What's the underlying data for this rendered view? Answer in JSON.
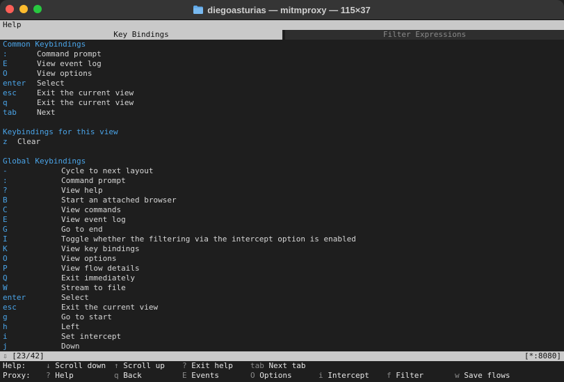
{
  "window": {
    "title": "diegoasturias — mitmproxy — 115×37"
  },
  "help_title": "Help",
  "tabs": [
    {
      "label": "Key Bindings",
      "active": true
    },
    {
      "label": "Filter Expressions",
      "active": false
    }
  ],
  "common": {
    "title": "Common Keybindings",
    "items": [
      {
        "key": ":",
        "desc": "Command prompt"
      },
      {
        "key": "E",
        "desc": "View event log"
      },
      {
        "key": "O",
        "desc": "View options"
      },
      {
        "key": "enter",
        "desc": "Select"
      },
      {
        "key": "esc",
        "desc": "Exit the current view"
      },
      {
        "key": "q",
        "desc": "Exit the current view"
      },
      {
        "key": "tab",
        "desc": "Next"
      }
    ]
  },
  "view": {
    "title": "Keybindings for this view",
    "items": [
      {
        "key": "z",
        "desc": "Clear"
      }
    ]
  },
  "global": {
    "title": "Global Keybindings",
    "items": [
      {
        "key": "-",
        "desc": "Cycle to next layout"
      },
      {
        "key": ":",
        "desc": "Command prompt"
      },
      {
        "key": "?",
        "desc": "View help"
      },
      {
        "key": "B",
        "desc": "Start an attached browser"
      },
      {
        "key": "C",
        "desc": "View commands"
      },
      {
        "key": "E",
        "desc": "View event log"
      },
      {
        "key": "G",
        "desc": "Go to end"
      },
      {
        "key": "I",
        "desc": "Toggle whether the filtering via the intercept option is enabled"
      },
      {
        "key": "K",
        "desc": "View key bindings"
      },
      {
        "key": "O",
        "desc": "View options"
      },
      {
        "key": "P",
        "desc": "View flow details"
      },
      {
        "key": "Q",
        "desc": "Exit immediately"
      },
      {
        "key": "W",
        "desc": "Stream to file"
      },
      {
        "key": "enter",
        "desc": "Select"
      },
      {
        "key": "esc",
        "desc": "Exit the current view"
      },
      {
        "key": "g",
        "desc": "Go to start"
      },
      {
        "key": "h",
        "desc": "Left"
      },
      {
        "key": "i",
        "desc": "Set intercept"
      },
      {
        "key": "j",
        "desc": "Down"
      }
    ]
  },
  "status": {
    "arrow": "⇩",
    "position": "[23/42]",
    "server": "[*:8080]"
  },
  "footer": {
    "help_label": "Help:",
    "help_items": [
      {
        "key": "↓",
        "label": "Scroll down"
      },
      {
        "key": "↑",
        "label": "Scroll up"
      },
      {
        "key": "?",
        "label": "Exit help"
      },
      {
        "key": "tab",
        "label": "Next tab"
      }
    ],
    "proxy_label": "Proxy:",
    "proxy_items": [
      {
        "key": "?",
        "label": "Help"
      },
      {
        "key": "q",
        "label": "Back"
      },
      {
        "key": "E",
        "label": "Events"
      },
      {
        "key": "O",
        "label": "Options"
      },
      {
        "key": "i",
        "label": "Intercept"
      },
      {
        "key": "f",
        "label": "Filter"
      },
      {
        "key": "w",
        "label": "Save flows"
      }
    ]
  }
}
